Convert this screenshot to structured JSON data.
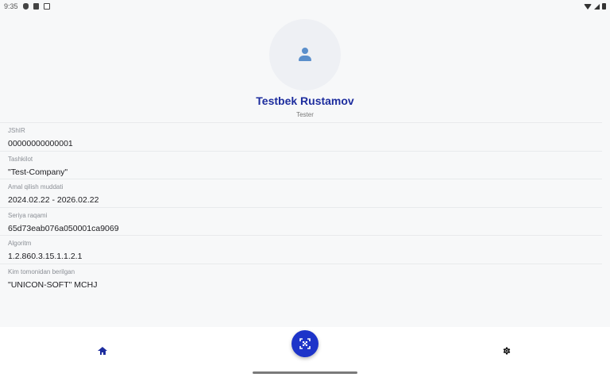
{
  "status_bar": {
    "time": "9:35",
    "left_icons": [
      "shield-icon",
      "clipboard-icon",
      "box-icon"
    ],
    "right_icons": [
      "wifi-icon",
      "signal-icon",
      "battery-icon"
    ]
  },
  "profile": {
    "avatar_icon": "person-icon",
    "name": "Testbek Rustamov",
    "role": "Tester"
  },
  "fields": [
    {
      "label": "JShIR",
      "value": "00000000000001"
    },
    {
      "label": "Tashkilot",
      "value": "\"Test-Company\""
    },
    {
      "label": "Amal qilish muddati",
      "value": "2024.02.22 - 2026.02.22"
    },
    {
      "label": "Seriya raqami",
      "value": "65d73eab076a050001ca9069"
    },
    {
      "label": "Algoritm",
      "value": "1.2.860.3.15.1.1.2.1"
    },
    {
      "label": "Kim tomonidan berilgan",
      "value": "\"UNICON-SOFT\" MCHJ"
    }
  ],
  "bottom_nav": {
    "home_icon": "home-icon",
    "scan_icon": "qr-scan-icon",
    "settings_icon": "gear-icon"
  },
  "colors": {
    "accent": "#1d34c9",
    "name_text": "#1d2d9e",
    "avatar_bg": "#eef0f4",
    "avatar_icon": "#5b8fcb",
    "background": "#f7f8f9"
  }
}
